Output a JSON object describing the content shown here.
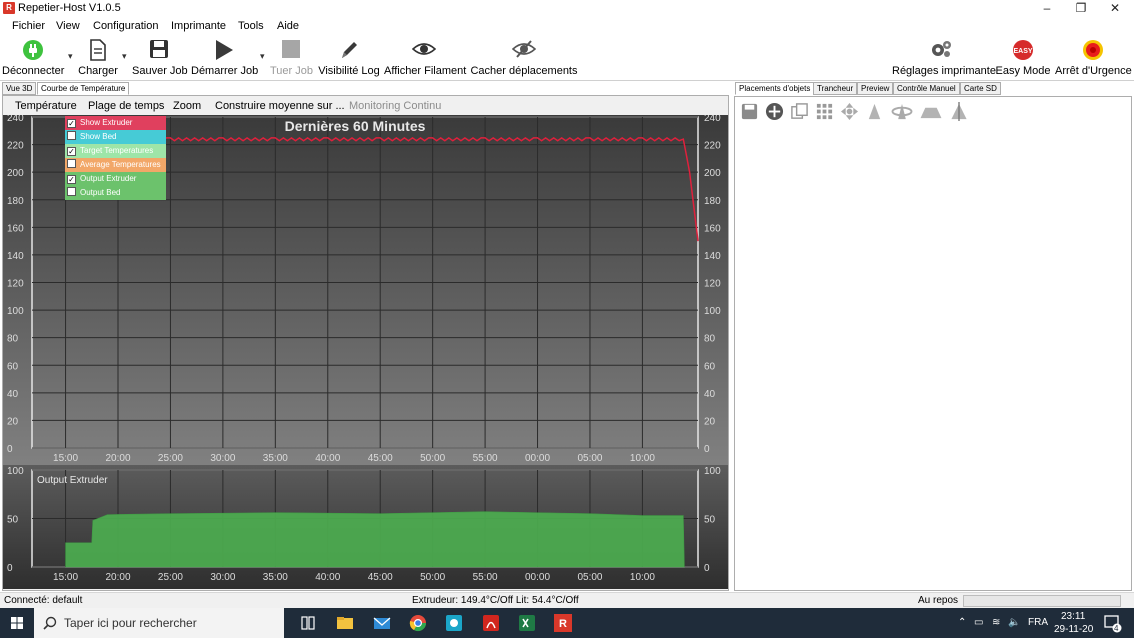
{
  "window": {
    "title": "Repetier-Host V1.0.5",
    "app_icon": "R"
  },
  "menu": [
    "Fichier",
    "View",
    "Configuration",
    "Imprimante",
    "Tools",
    "Aide"
  ],
  "toolbar": {
    "disconnect": "Déconnecter",
    "load": "Charger",
    "save_job": "Sauver Job",
    "start_job": "Démarrer Job",
    "kill_job": "Tuer Job",
    "log_visibility": "Visibilité Log",
    "show_filament": "Afficher Filament",
    "hide_moves": "Cacher  déplacements",
    "printer_settings": "Réglages imprimante",
    "easy_mode": "Easy Mode",
    "easy_badge": "EASY",
    "emergency_stop": "Arrêt d'Urgence"
  },
  "left_tabs": [
    "Vue 3D",
    "Courbe de Température"
  ],
  "temp_subtabs": [
    "Température",
    "Plage de temps",
    "Zoom",
    "Construire moyenne sur ...",
    "Monitoring Continu"
  ],
  "legend": [
    {
      "label": "Show Extruder",
      "checked": true,
      "color": "#e0405e"
    },
    {
      "label": "Show Bed",
      "checked": false,
      "color": "#46cbd6"
    },
    {
      "label": "Target Temperatures",
      "checked": true,
      "color": "#9ee5a8"
    },
    {
      "label": "Average Temperatures",
      "checked": false,
      "color": "#f2a768"
    },
    {
      "label": "Output Extruder",
      "checked": true,
      "color": "#6cc26c"
    },
    {
      "label": "Output Bed",
      "checked": false,
      "color": "#6cc26c"
    }
  ],
  "chart_data": [
    {
      "type": "line",
      "title": "Dernières 60 Minutes",
      "x_ticks": [
        "15:00",
        "20:00",
        "25:00",
        "30:00",
        "35:00",
        "40:00",
        "45:00",
        "50:00",
        "55:00",
        "00:00",
        "05:00",
        "10:00"
      ],
      "y_ticks": [
        0,
        20,
        40,
        60,
        80,
        100,
        120,
        140,
        160,
        180,
        200,
        220,
        240
      ],
      "ylim": [
        0,
        240
      ],
      "series": [
        {
          "name": "Show Extruder",
          "color": "#e0203c",
          "x": [
            0,
            2,
            2.5,
            5,
            10,
            15,
            20,
            25,
            30,
            35,
            40,
            45,
            50,
            55,
            58.9,
            59.5,
            60.5
          ],
          "values": [
            220,
            219,
            224,
            224,
            224,
            224,
            224,
            224,
            224,
            224,
            224,
            224,
            224,
            224,
            224,
            200,
            150
          ]
        }
      ]
    },
    {
      "type": "area",
      "title": "Output Extruder",
      "x_ticks": [
        "15:00",
        "20:00",
        "25:00",
        "30:00",
        "35:00",
        "40:00",
        "45:00",
        "50:00",
        "55:00",
        "00:00",
        "05:00",
        "10:00"
      ],
      "y_ticks": [
        0,
        50,
        100
      ],
      "ylim": [
        0,
        100
      ],
      "series": [
        {
          "name": "Output Extruder",
          "color": "#4caf50",
          "x": [
            0,
            2.5,
            2.6,
            4,
            10,
            20,
            30,
            40,
            50,
            55,
            58.9,
            59
          ],
          "values": [
            25,
            25,
            48,
            54,
            55,
            56,
            55,
            57,
            55,
            53,
            53,
            0
          ]
        }
      ]
    }
  ],
  "right_tabs": [
    "Placements d'objets",
    "Trancheur",
    "Preview",
    "Contrôle Manuel",
    "Carte SD"
  ],
  "status": {
    "connection": "Connecté: default",
    "temps": "Extrudeur: 149.4°C/Off Lit: 54.4°C/Off",
    "state": "Au repos"
  },
  "taskbar": {
    "search_placeholder": "Taper ici pour rechercher",
    "lang": "FRA",
    "time": "23:11",
    "date": "29-11-20",
    "notif_count": "4"
  }
}
